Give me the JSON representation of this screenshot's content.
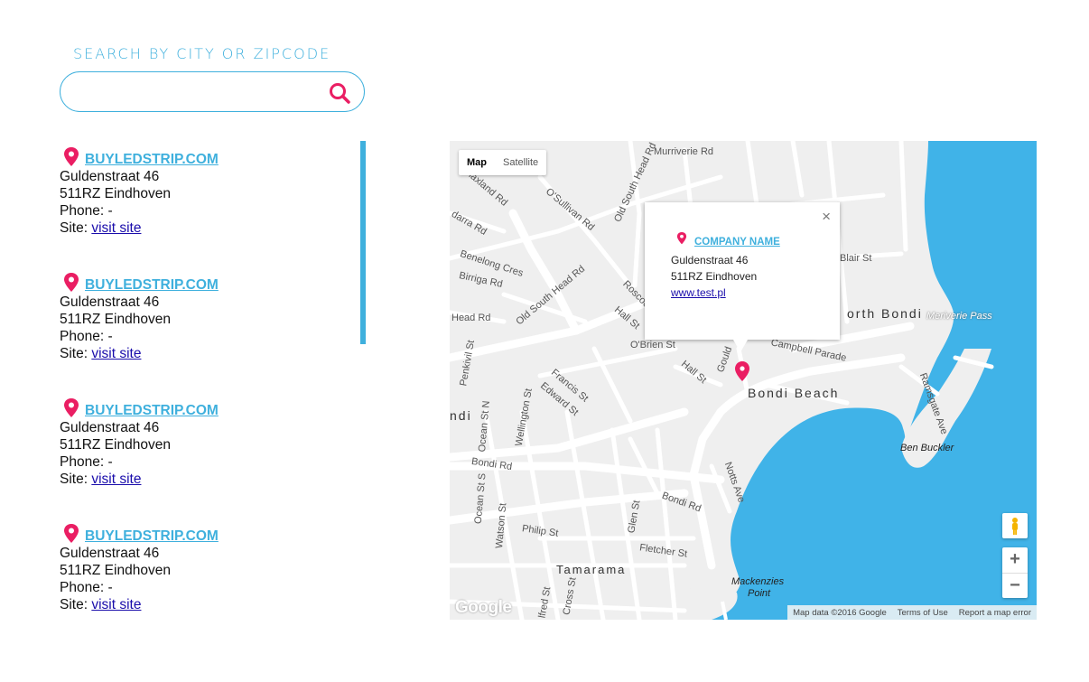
{
  "search": {
    "title": "SEARCH BY CITY OR ZIPCODE",
    "value": "",
    "placeholder": ""
  },
  "colors": {
    "accent": "#3fb0dd",
    "pin": "#ea1e63",
    "water": "#40b3e8",
    "link": "#1a0dab"
  },
  "results": [
    {
      "name": "BUYLEDSTRIP.COM",
      "street": "Guldenstraat 46",
      "city": "511RZ Eindhoven",
      "phone_label": "Phone: ",
      "phone": "-",
      "site_label": "Site: ",
      "site_link": "visit site"
    },
    {
      "name": "BUYLEDSTRIP.COM",
      "street": "Guldenstraat 46",
      "city": "511RZ Eindhoven",
      "phone_label": "Phone: ",
      "phone": "-",
      "site_label": "Site: ",
      "site_link": "visit site"
    },
    {
      "name": "BUYLEDSTRIP.COM",
      "street": "Guldenstraat 46",
      "city": "511RZ Eindhoven",
      "phone_label": "Phone: ",
      "phone": "-",
      "site_label": "Site: ",
      "site_link": "visit site"
    },
    {
      "name": "BUYLEDSTRIP.COM",
      "street": "Guldenstraat 46",
      "city": "511RZ Eindhoven",
      "phone_label": "Phone: ",
      "phone": "-",
      "site_label": "Site: ",
      "site_link": "visit site"
    }
  ],
  "map": {
    "type_map": "Map",
    "type_satellite": "Satellite",
    "popup": {
      "close": "×",
      "title": "COMPANY NAME",
      "street": "Guldenstraat 46",
      "city": "511RZ Eindhoven",
      "url": "www.test.pl"
    },
    "zoom_in": "+",
    "zoom_out": "−",
    "logo": "Google",
    "attribution": {
      "data": "Map data ©2016 Google",
      "terms": "Terms of Use",
      "report": "Report a map error"
    },
    "labels": {
      "murriverie": "Murriverie Rd",
      "osullivan": "O'Sullivan Rd",
      "oldsouthhead1": "Old South Head Rd",
      "oldsouthhead2": "Old South Head Rd",
      "benelong": "Benelong Cres",
      "birriga": "Birriga Rd",
      "bondi_label": "Bondi",
      "north_bondi": "orth Bondi",
      "meriverie_pass": "Meriverie Pass",
      "blair": "Blair St",
      "campbell": "Campbell Parade",
      "roscoe": "Roscoe",
      "hall1": "Hall St",
      "hall2": "Hall St",
      "obrien": "O'Brien St",
      "gould": "Gould",
      "bondi_beach": "Bondi Beach",
      "ramsgate": "Ramsgate Ave",
      "ben_buckler": "Ben Buckler",
      "francis": "Francis St",
      "edward": "Edward St",
      "wellington": "Wellington St",
      "ocean_n": "Ocean St N",
      "penkivil": "Penkivil St",
      "head_rd": "Head Rd",
      "ndi": "ndi",
      "bondi_rd1": "Bondi Rd",
      "bondi_rd2": "Bondi Rd",
      "ocean_s": "Ocean St S",
      "watson": "Watson St",
      "philip": "Philip St",
      "glen": "Glen St",
      "fletcher": "Fletcher St",
      "notts": "Notts Ave",
      "tamarama": "Tamarama",
      "mackenzies": "Mackenzies",
      "point": "Point",
      "cross": "Cross St",
      "alfred": "lfred St",
      "blaxland": "Blaxland Rd",
      "darra": "darra Rd",
      "rd_top": "Rd",
      "birrigar_rd": "Rosco"
    }
  }
}
